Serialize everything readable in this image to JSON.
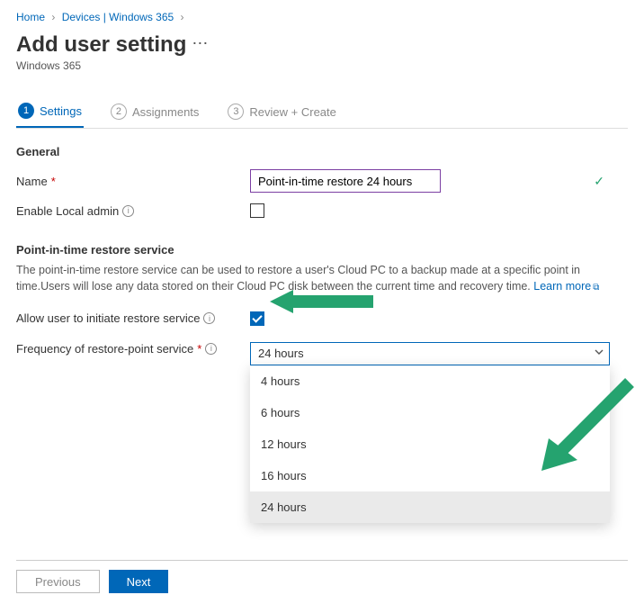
{
  "breadcrumb": {
    "home": "Home",
    "devices": "Devices | Windows 365"
  },
  "header": {
    "title": "Add user setting",
    "subtitle": "Windows 365"
  },
  "tabs": {
    "settings": "Settings",
    "assignments": "Assignments",
    "review": "Review + Create"
  },
  "general": {
    "section": "General",
    "name_label": "Name",
    "name_value": "Point-in-time restore 24 hours",
    "local_admin_label": "Enable Local admin"
  },
  "restore": {
    "section": "Point-in-time restore service",
    "description": "The point-in-time restore service can be used to restore a user's Cloud PC to a backup made at a specific point in time.Users will lose any data stored on their Cloud PC disk between the current time and recovery time.",
    "learn_more": "Learn more",
    "allow_label": "Allow user to initiate restore service",
    "frequency_label": "Frequency of restore-point service",
    "frequency_selected": "24 hours",
    "options": [
      "4 hours",
      "6 hours",
      "12 hours",
      "16 hours",
      "24 hours"
    ]
  },
  "buttons": {
    "previous": "Previous",
    "next": "Next"
  }
}
